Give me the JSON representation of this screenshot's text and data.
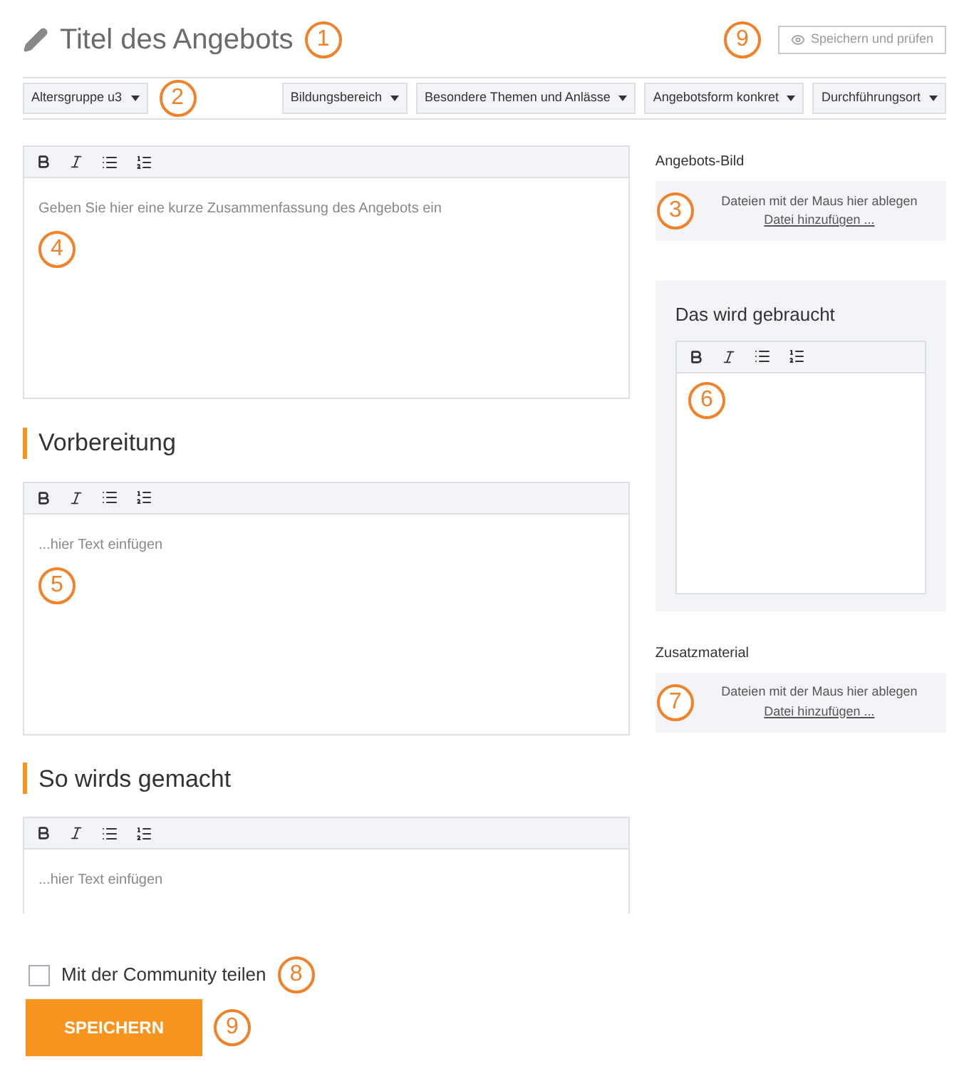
{
  "header": {
    "title": "Titel des Angebots",
    "title_callout": "1",
    "callout": "9",
    "preview_button": "Speichern und prüfen"
  },
  "filters": {
    "callout": "2",
    "left": [
      {
        "label": "Altersgruppe u3"
      }
    ],
    "right": [
      {
        "label": "Bildungsbereich"
      },
      {
        "label": "Besondere Themen und Anlässe"
      },
      {
        "label": "Angebotsform konkret"
      },
      {
        "label": "Durchführungsort"
      }
    ]
  },
  "main": [
    {
      "placeholder": "Geben Sie hier eine kurze Zusammenfassung des Angebots ein",
      "callout": "4",
      "truncated": false
    },
    {
      "heading": "Vorbereitung",
      "placeholder": "...hier Text einfügen",
      "callout": "5",
      "truncated": false
    },
    {
      "heading": "So wirds gemacht",
      "placeholder": "...hier Text einfügen",
      "truncated": true
    }
  ],
  "sidebar": [
    {
      "kind": "upload",
      "label": "Angebots-Bild",
      "drop_text": "Dateien mit der Maus hier ablegen",
      "link": "Datei hinzufügen ...",
      "callout": "3"
    },
    {
      "kind": "editor",
      "heading": "Das wird gebraucht",
      "callout": "6"
    },
    {
      "kind": "upload",
      "label": "Zusatzmaterial",
      "drop_text": "Dateien mit der Maus hier ablegen",
      "link": "Datei hinzufügen ...",
      "callout": "7"
    }
  ],
  "footer": {
    "share": {
      "label": "Mit der Community teilen",
      "checked": false,
      "callout": "8"
    },
    "save_button": "SPEICHERN",
    "callout": "9"
  }
}
